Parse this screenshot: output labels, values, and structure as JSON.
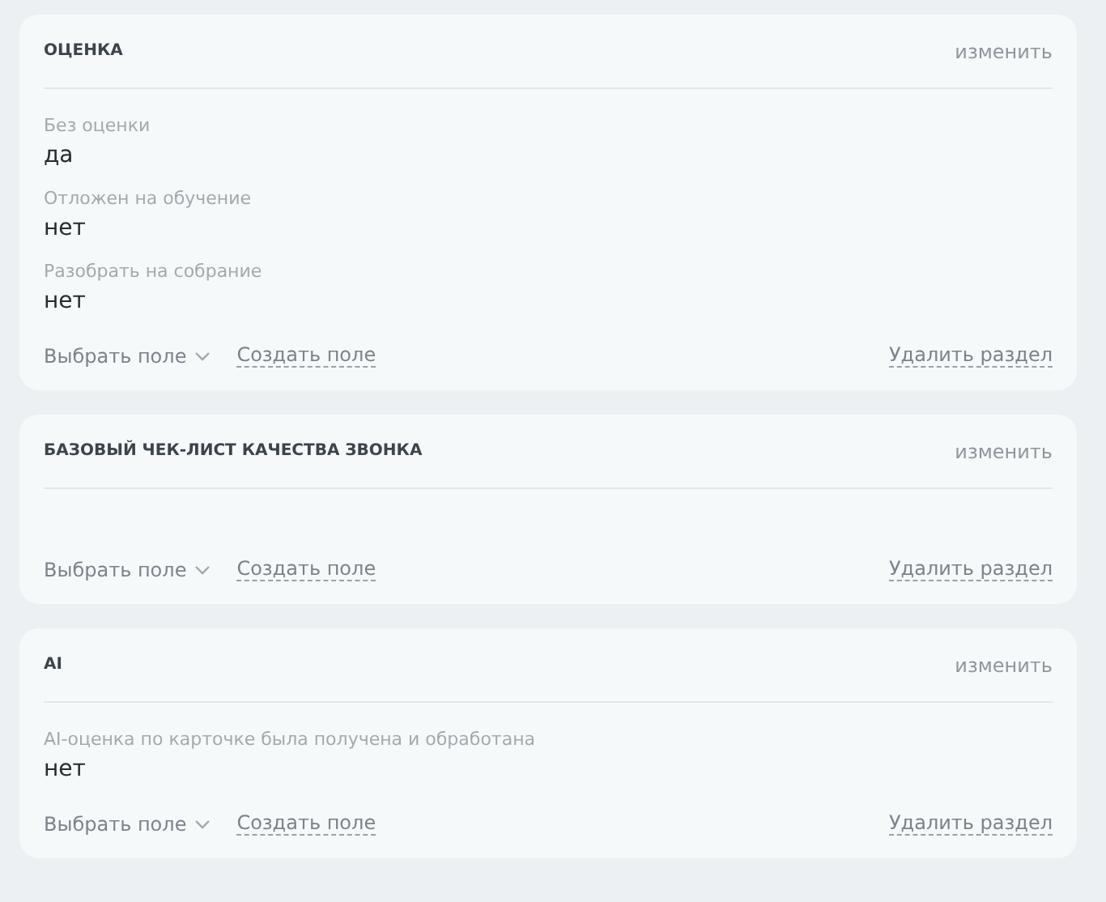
{
  "sections": [
    {
      "title": "ОЦЕНКА",
      "edit": "изменить",
      "fields": [
        {
          "label": "Без оценки",
          "value": "да"
        },
        {
          "label": "Отложен на обучение",
          "value": "нет"
        },
        {
          "label": "Разобрать на собрание",
          "value": "нет"
        }
      ],
      "select_field": "Выбрать поле",
      "create_field": "Создать поле",
      "delete_section": "Удалить раздел"
    },
    {
      "title": "БАЗОВЫЙ ЧЕК-ЛИСТ КАЧЕСТВА ЗВОНКА",
      "edit": "изменить",
      "select_field": "Выбрать поле",
      "create_field": "Создать поле",
      "delete_section": "Удалить раздел"
    },
    {
      "title": "AI",
      "edit": "изменить",
      "fields": [
        {
          "label": "AI-оценка по карточке была получена и обработана",
          "value": "нет"
        }
      ],
      "select_field": "Выбрать поле",
      "create_field": "Создать поле",
      "delete_section": "Удалить раздел"
    }
  ]
}
